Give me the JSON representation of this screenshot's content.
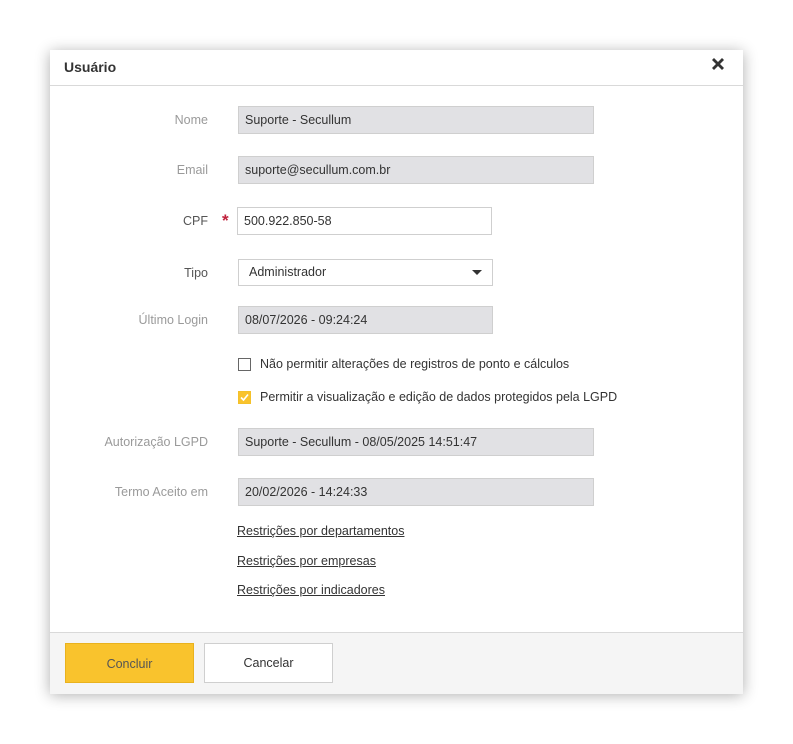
{
  "dialog": {
    "title": "Usuário",
    "close_icon": "close-x-icon"
  },
  "form": {
    "nome": {
      "label": "Nome",
      "value": "Suporte - Secullum"
    },
    "email": {
      "label": "Email",
      "value": "suporte@secullum.com.br"
    },
    "cpf": {
      "label": "CPF",
      "required_mark": "*",
      "value": "500.922.850-58"
    },
    "tipo": {
      "label": "Tipo",
      "value": "Administrador"
    },
    "ultimo_login": {
      "label": "Último Login",
      "value": "08/07/2026 - 09:24:24"
    },
    "checkbox_alteracoes": {
      "label": "Não permitir alterações de registros de ponto e cálculos",
      "checked": false
    },
    "checkbox_lgpd": {
      "label": "Permitir a visualização e edição de dados protegidos pela LGPD",
      "checked": true
    },
    "autorizacao_lgpd": {
      "label": "Autorização LGPD",
      "value": "Suporte - Secullum - 08/05/2025 14:51:47"
    },
    "termo_aceito": {
      "label": "Termo Aceito em",
      "value": "20/02/2026 - 14:24:33"
    }
  },
  "links": {
    "departamentos": "Restrições por departamentos",
    "empresas": "Restrições por empresas",
    "indicadores": "Restrições por indicadores"
  },
  "footer": {
    "concluir": "Concluir",
    "cancelar": "Cancelar"
  },
  "colors": {
    "accent": "#f9c32d",
    "required": "#c0203b",
    "readonly_bg": "#e1e1e4"
  }
}
